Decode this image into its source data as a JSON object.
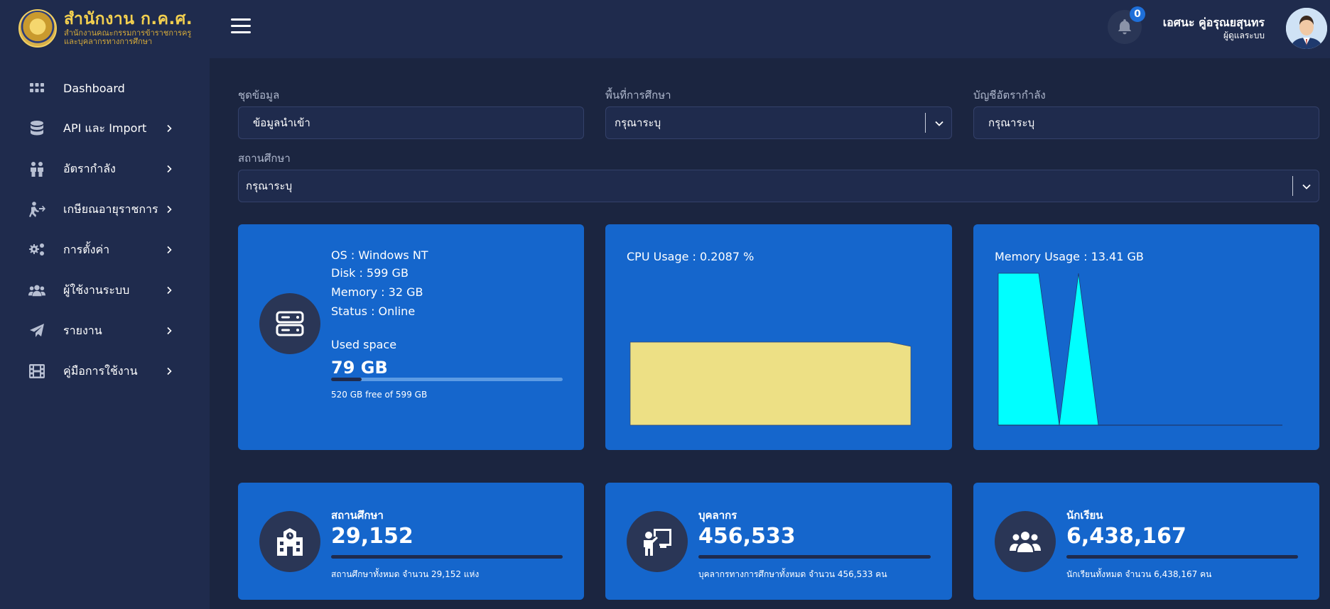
{
  "header": {
    "org_name": "สำนักงาน ก.ค.ศ.",
    "org_sub_line1": "สำนักงานคณะกรรมการข้าราชการครู",
    "org_sub_line2": "และบุคลากรทางการศึกษา",
    "notification_count": "0",
    "user_name": "เอศนะ คู่อรุณยสุนทร",
    "user_role": "ผู้ดูแลระบบ"
  },
  "sidebar": {
    "items": [
      {
        "label": "Dashboard",
        "icon": "grid-icon"
      },
      {
        "label": "API และ Import",
        "icon": "database-icon"
      },
      {
        "label": "อัตรากำลัง",
        "icon": "people-icon"
      },
      {
        "label": "เกษียณอายุราชการ",
        "icon": "person-exit-icon"
      },
      {
        "label": "การตั้งค่า",
        "icon": "gears-icon"
      },
      {
        "label": "ผู้ใช้งานระบบ",
        "icon": "users-icon"
      },
      {
        "label": "รายงาน",
        "icon": "paper-plane-icon"
      },
      {
        "label": "คู่มือการใช้งาน",
        "icon": "film-icon"
      }
    ]
  },
  "filters": {
    "dataset": {
      "label": "ชุดข้อมูล",
      "value": "ข้อมูลนำเข้า"
    },
    "area": {
      "label": "พื้นที่การศึกษา",
      "value": "กรุณาระบุ"
    },
    "account": {
      "label": "บัญชีอัตรากำลัง",
      "value": "กรุณาระบุ"
    },
    "school": {
      "label": "สถานศึกษา",
      "value": "กรุณาระบุ"
    }
  },
  "server": {
    "os": "OS : Windows NT",
    "disk": "Disk : 599 GB",
    "memory": "Memory : 32 GB",
    "status": "Status : Online",
    "used_label": "Used space",
    "used_value": "79 GB",
    "used_fraction": 0.132,
    "free_text": "520 GB free of 599 GB"
  },
  "cpu": {
    "title": "CPU Usage : 0.2087 %"
  },
  "memory_usage": {
    "title": "Memory Usage : 13.41 GB"
  },
  "stats": [
    {
      "title": "สถานศึกษา",
      "value": "29,152",
      "desc": "สถานศึกษาทั้งหมด จำนวน 29,152 แห่ง",
      "icon": "school-icon"
    },
    {
      "title": "บุคลากร",
      "value": "456,533",
      "desc": "บุคลากรทางการศึกษาทั้งหมด จำนวน 456,533 คน",
      "icon": "teacher-icon"
    },
    {
      "title": "นักเรียน",
      "value": "6,438,167",
      "desc": "นักเรียนทั้งหมด จำนวน 6,438,167 คน",
      "icon": "students-icon"
    }
  ],
  "colors": {
    "background": "#1b2540",
    "panel": "#1f2b4d",
    "card": "#1566cc",
    "cpu_fill": "#ede085",
    "memory_fill": "#00ffff",
    "logo_gold": "#f2cf4f"
  }
}
